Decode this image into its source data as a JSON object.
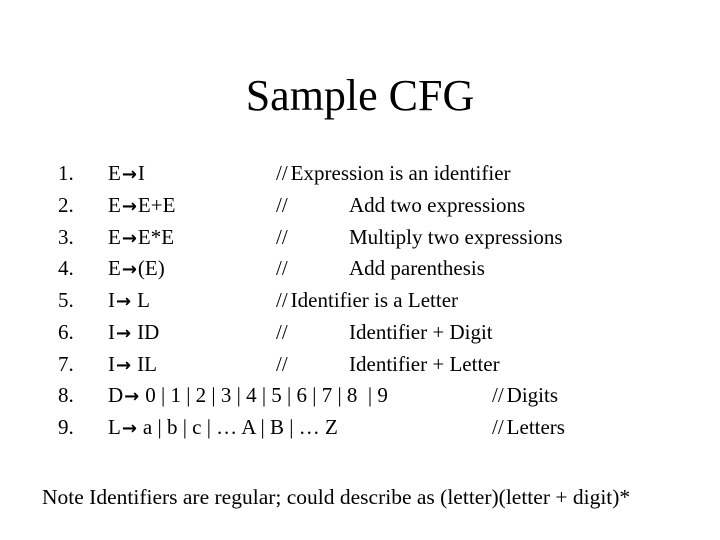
{
  "slide": {
    "title": "Sample CFG",
    "arrow_glyph": "→",
    "rules": [
      {
        "number": "1.",
        "lhs": "E",
        "rhs": "I",
        "comment_prefix": "//",
        "comment": "Expression is an identifier",
        "comment_style": "inline"
      },
      {
        "number": "2.",
        "lhs": "E",
        "rhs": "E+E",
        "comment_prefix": "//",
        "comment": "Add two expressions",
        "comment_style": "indent"
      },
      {
        "number": "3.",
        "lhs": "E",
        "rhs": "E*E",
        "comment_prefix": "//",
        "comment": "Multiply two expressions",
        "comment_style": "indent"
      },
      {
        "number": "4.",
        "lhs": "E",
        "rhs": "(E)",
        "comment_prefix": "//",
        "comment": "Add parenthesis",
        "comment_style": "indent"
      },
      {
        "number": "5.",
        "lhs": "I",
        "rhs": "L",
        "comment_prefix": "//",
        "comment": "Identifier is a Letter",
        "comment_style": "inline"
      },
      {
        "number": "6.",
        "lhs": "I",
        "rhs": "ID",
        "comment_prefix": "//",
        "comment": "Identifier + Digit",
        "comment_style": "indent"
      },
      {
        "number": "7.",
        "lhs": "I",
        "rhs": "IL",
        "comment_prefix": "//",
        "comment": "Identifier + Letter",
        "comment_style": "indent"
      },
      {
        "number": "8.",
        "lhs": "D",
        "rhs": "0 | 1 | 2 | 3 | 4 | 5 | 6 | 7 | 8  | 9",
        "comment_prefix": "//",
        "comment": "Digits",
        "comment_style": "far"
      },
      {
        "number": "9.",
        "lhs": "L",
        "rhs": "a | b | c | … A | B | … Z",
        "comment_prefix": "//",
        "comment": "Letters",
        "comment_style": "far"
      }
    ],
    "note": "Note Identifiers are regular; could describe as (letter)(letter + digit)*"
  }
}
